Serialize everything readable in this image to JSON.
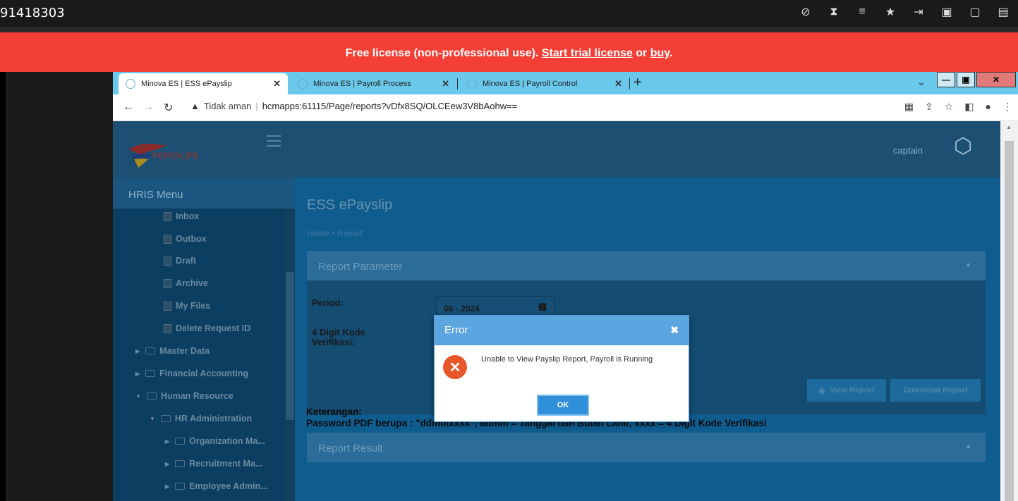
{
  "taskbar": {
    "number_text": "91418303"
  },
  "license_banner": {
    "prefix": "Free license (non-professional use).",
    "trial_link": "Start trial license",
    "or_text": "or",
    "buy_link": "buy",
    "suffix": ".",
    "color": "#f43f36"
  },
  "browser": {
    "tabs": [
      {
        "label": "Minova ES | ESS ePayslip",
        "active": true
      },
      {
        "label": "Minova ES | Payroll Process",
        "active": false
      },
      {
        "label": "Minova ES | Payroll Control",
        "active": false
      }
    ],
    "new_tab": "+",
    "security_label": "Tidak aman",
    "url": "hcmapps:61115/Page/reports?vDfx8SQ/OLCEew3V8bAohw==",
    "tabbar_color": "#6ac8ea"
  },
  "app": {
    "logo_text": "PERTALIFE",
    "user_name": "captain",
    "sidebar": {
      "title": "HRIS Menu",
      "items": [
        {
          "label": "Inbox"
        },
        {
          "label": "Outbox"
        },
        {
          "label": "Draft"
        },
        {
          "label": "Archive"
        },
        {
          "label": "My Files"
        },
        {
          "label": "Delete Request ID"
        },
        {
          "label": "Master Data"
        },
        {
          "label": "Financial Accounting"
        },
        {
          "label": "Human Resource"
        },
        {
          "label": "HR Administration"
        },
        {
          "label": "Organization Ma..."
        },
        {
          "label": "Recruitment Ma..."
        },
        {
          "label": "Employee Admin..."
        }
      ]
    },
    "page_title": "ESS ePayslip",
    "breadcrumb": {
      "home": "Home",
      "sep": "•",
      "current": "Report"
    },
    "report_parameter": {
      "title": "Report Parameter",
      "period_label": "Period:",
      "period_value": "06 - 2024",
      "kode_label_1": "4 Digit Kode",
      "kode_label_2": "Verifikasi:",
      "view_button": "View Report",
      "download_button": "Download Report"
    },
    "keterangan": {
      "line1": "Keterangan:",
      "line2": "Password PDF berupa : \"ddmmxxxx\", ddmm = Tanggal dan Bulan Lahir, xxxx = 4 Digit Kode Verifikasi"
    },
    "report_result": {
      "title": "Report Result"
    }
  },
  "modal": {
    "title": "Error",
    "message": "Unable to View Payslip Report, Payroll is Running",
    "ok_label": "OK",
    "header_color": "#5ba5e0"
  }
}
